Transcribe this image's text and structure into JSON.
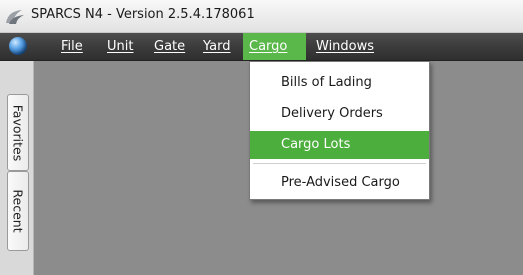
{
  "window": {
    "title": "SPARCS N4 - Version 2.5.4.178061",
    "app_icon": "sparcs-logo-icon"
  },
  "menubar": {
    "globe_icon": "globe-icon",
    "items": [
      {
        "label": "File"
      },
      {
        "label": "Unit"
      },
      {
        "label": "Gate"
      },
      {
        "label": "Yard"
      },
      {
        "label": "Cargo",
        "active": true
      },
      {
        "label": "Windows"
      }
    ]
  },
  "sidebar": {
    "tabs": [
      {
        "label": "Favorites"
      },
      {
        "label": "Recent"
      }
    ]
  },
  "cargo_menu": {
    "items": [
      {
        "label": "Bills of Lading"
      },
      {
        "label": "Delivery Orders"
      },
      {
        "label": "Cargo Lots",
        "highlighted": true
      },
      {
        "label": "Pre-Advised Cargo"
      }
    ]
  },
  "colors": {
    "menubar_bg": "#3c3c3c",
    "active_menu": "#5ab749",
    "highlight": "#4cae3c",
    "workspace_bg": "#8c8c8c"
  }
}
